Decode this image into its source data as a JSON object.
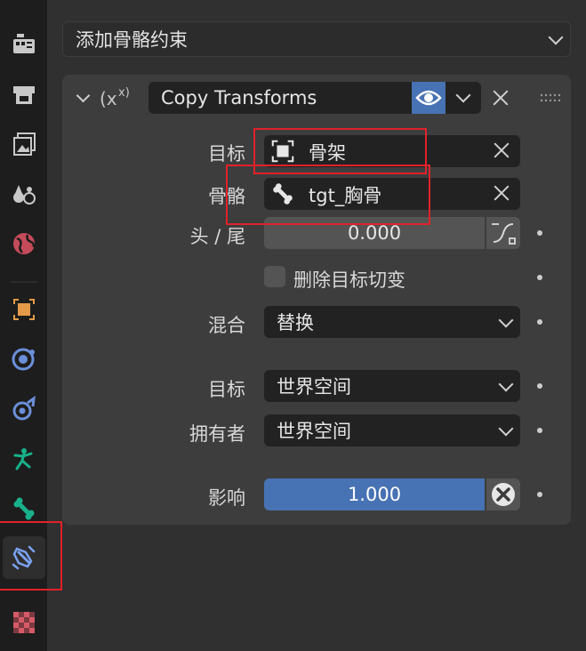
{
  "sidebar": {
    "tabs": [
      {
        "icon": "tool-settings-icon"
      },
      {
        "icon": "render-icon"
      },
      {
        "icon": "output-icon"
      },
      {
        "icon": "view-layer-icon"
      },
      {
        "icon": "world-icon"
      },
      {
        "icon": "object-icon"
      },
      {
        "icon": "modifiers-icon"
      },
      {
        "icon": "physics-icon"
      },
      {
        "icon": "object-data-armature-icon"
      },
      {
        "icon": "bone-icon"
      },
      {
        "icon": "bone-constraint-icon",
        "active": true
      },
      {
        "icon": "texture-icon"
      }
    ]
  },
  "add_constraint": {
    "label": "添加骨骼约束"
  },
  "constraint": {
    "name": "Copy Transforms",
    "target": {
      "label": "目标",
      "value": "骨架"
    },
    "bone": {
      "label": "骨骼",
      "value": "tgt_胸骨"
    },
    "head_tail": {
      "label": "头 / 尾",
      "value": "0.000"
    },
    "remove_shear": {
      "label": "删除目标切变",
      "checked": false
    },
    "mix": {
      "label": "混合",
      "value": "替换"
    },
    "target_space": {
      "label": "目标",
      "value": "世界空间"
    },
    "owner_space": {
      "label": "拥有者",
      "value": "世界空间"
    },
    "influence": {
      "label": "影响",
      "value": "1.000",
      "fraction": 1.0
    }
  },
  "colors": {
    "accent": "#4772b3",
    "influence_fill": "#4772b3",
    "highlight": "#e0222a",
    "armature_green": "#18b08a",
    "object_orange": "#e59a49"
  }
}
